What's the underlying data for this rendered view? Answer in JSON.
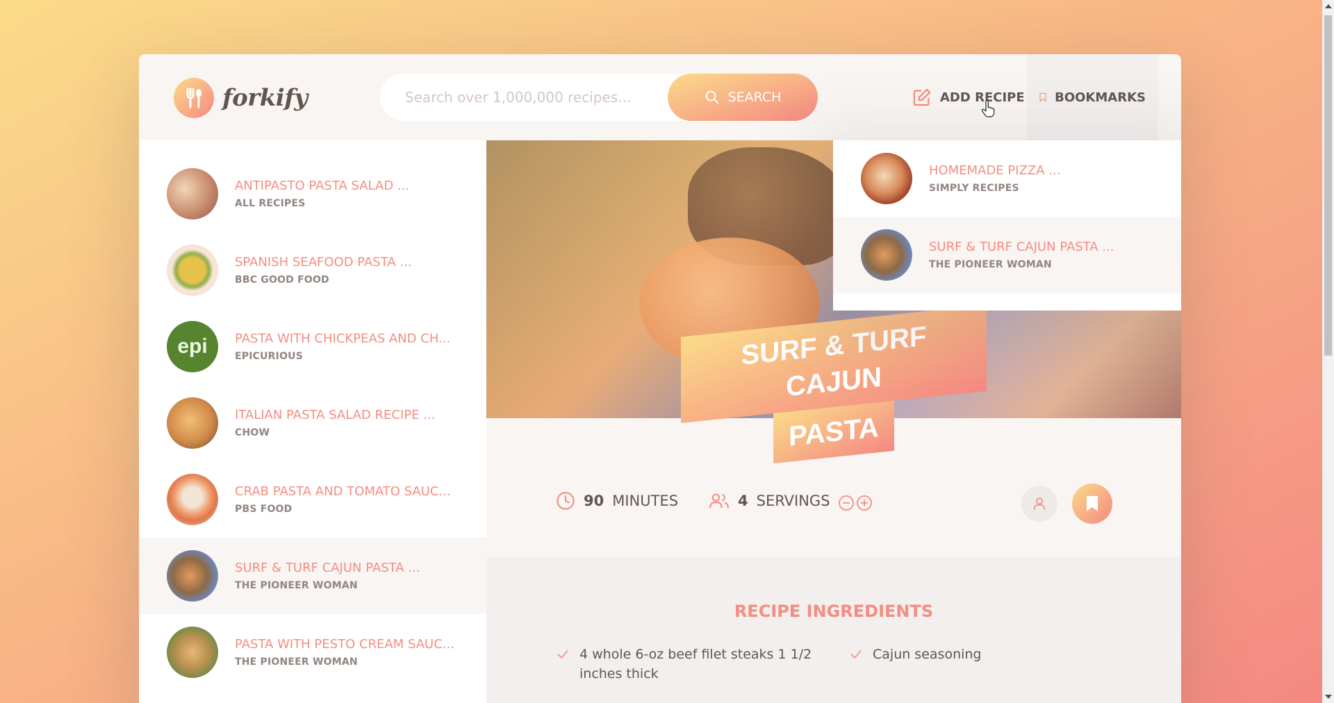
{
  "header": {
    "logo_text": "forkify",
    "search_placeholder": "Search over 1,000,000 recipes...",
    "search_button": "SEARCH",
    "add_recipe": "ADD RECIPE",
    "bookmarks": "BOOKMARKS"
  },
  "results": [
    {
      "title": "ANTIPASTO PASTA SALAD ...",
      "publisher": "ALL RECIPES",
      "thumb_icon": "pasta-salad-photo"
    },
    {
      "title": "SPANISH SEAFOOD PASTA ...",
      "publisher": "BBC GOOD FOOD",
      "thumb_icon": "seafood-pasta-photo"
    },
    {
      "title": "PASTA WITH CHICKPEAS AND CH...",
      "publisher": "EPICURIOUS",
      "thumb_text": "epi"
    },
    {
      "title": "ITALIAN PASTA SALAD RECIPE ...",
      "publisher": "CHOW",
      "thumb_icon": "pasta-photo"
    },
    {
      "title": "CRAB PASTA AND TOMATO SAUC...",
      "publisher": "PBS FOOD",
      "thumb_icon": "crab-pasta-photo"
    },
    {
      "title": "SURF & TURF CAJUN PASTA ...",
      "publisher": "THE PIONEER WOMAN",
      "thumb_icon": "surf-turf-photo",
      "active": true
    },
    {
      "title": "PASTA WITH PESTO CREAM SAUC...",
      "publisher": "THE PIONEER WOMAN",
      "thumb_icon": "pesto-pasta-photo"
    }
  ],
  "bookmarks": [
    {
      "title": "HOMEMADE PIZZA ...",
      "publisher": "SIMPLY RECIPES"
    },
    {
      "title": "SURF & TURF CAJUN PASTA ...",
      "publisher": "THE PIONEER WOMAN",
      "active": true
    }
  ],
  "recipe": {
    "title_line1": "SURF & TURF CAJUN",
    "title_line2": "PASTA",
    "cooking_time": "90",
    "time_unit": "MINUTES",
    "servings": "4",
    "servings_unit": "SERVINGS",
    "ingredients_heading": "RECIPE INGREDIENTS",
    "ingredients": [
      "4 whole 6-oz beef filet steaks 1 1/2 inches thick",
      "Cajun seasoning"
    ]
  },
  "colors": {
    "accent": "#f38e82",
    "gradient_start": "#fbdb89",
    "gradient_end": "#f48982",
    "text": "#615551",
    "panel_bg": "#f9f5f3"
  }
}
